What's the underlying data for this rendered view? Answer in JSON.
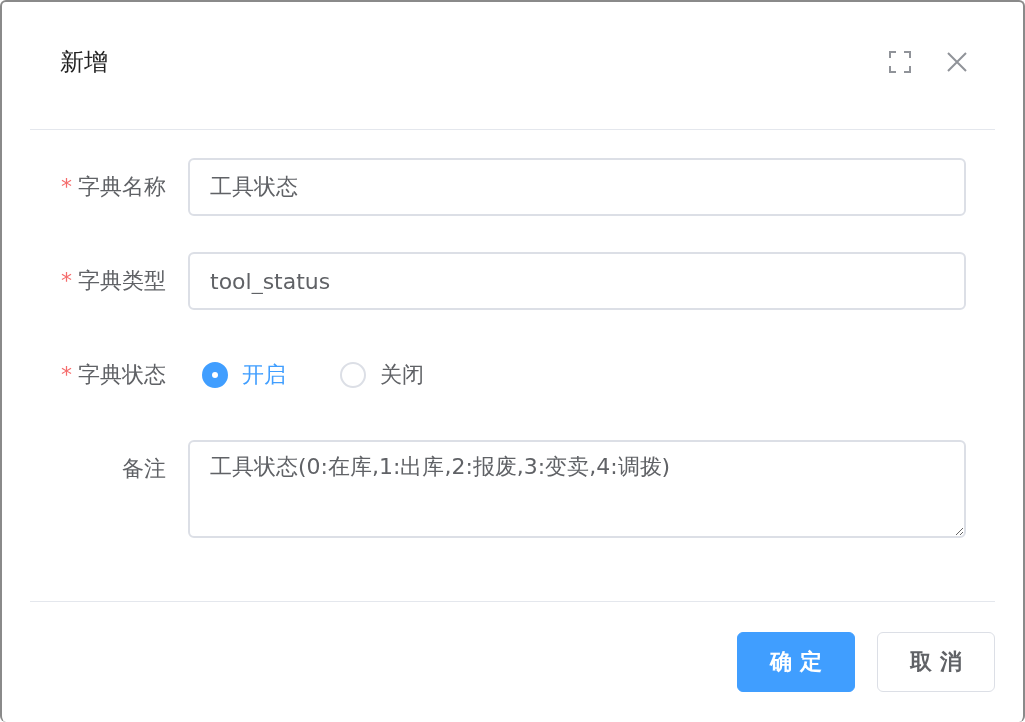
{
  "dialog": {
    "title": "新增",
    "fields": [
      {
        "kind": "input",
        "required_mark": "*",
        "label": "字典名称",
        "value": "工具状态"
      },
      {
        "kind": "input",
        "required_mark": "*",
        "label": "字典类型",
        "value": "tool_status"
      },
      {
        "kind": "radio",
        "required_mark": "*",
        "label": "字典状态",
        "options": [
          {
            "label": "开启",
            "selected": true
          },
          {
            "label": "关闭",
            "selected": false
          }
        ]
      },
      {
        "kind": "textarea",
        "label": "备注",
        "value": "工具状态(0:在库,1:出库,2:报废,3:变卖,4:调拨)"
      }
    ],
    "buttons": [
      {
        "kind": "primary",
        "label": "确 定"
      },
      {
        "kind": "default",
        "label": "取 消"
      }
    ]
  }
}
